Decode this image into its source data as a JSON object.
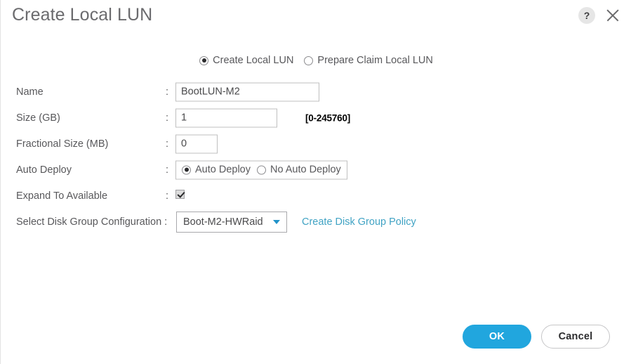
{
  "dialog": {
    "title": "Create Local LUN",
    "help_icon": "question-mark-icon",
    "close_icon": "close-icon"
  },
  "mode": {
    "options": [
      {
        "label": "Create Local LUN",
        "selected": true
      },
      {
        "label": "Prepare Claim Local LUN",
        "selected": false
      }
    ]
  },
  "form": {
    "colon": ":",
    "name": {
      "label": "Name",
      "value": "BootLUN-M2",
      "placeholder": ""
    },
    "size": {
      "label": "Size (GB)",
      "value": "1",
      "hint": "[0-245760]"
    },
    "fractional_size": {
      "label": "Fractional Size (MB)",
      "value": "0"
    },
    "auto_deploy": {
      "label": "Auto Deploy",
      "options": [
        {
          "label": "Auto Deploy",
          "selected": true
        },
        {
          "label": "No Auto Deploy",
          "selected": false
        }
      ]
    },
    "expand_to_available": {
      "label": "Expand To Available",
      "checked": true
    },
    "disk_group": {
      "label": "Select Disk Group Configuration :",
      "selected": "Boot-M2-HWRaid",
      "caret_icon": "chevron-down-icon",
      "link": "Create Disk Group Policy"
    }
  },
  "footer": {
    "ok": "OK",
    "cancel": "Cancel"
  },
  "colors": {
    "accent_blue": "#21a6de",
    "link_teal": "#41a3c4",
    "text_gray": "#58585b",
    "hint_black": "#000000"
  }
}
